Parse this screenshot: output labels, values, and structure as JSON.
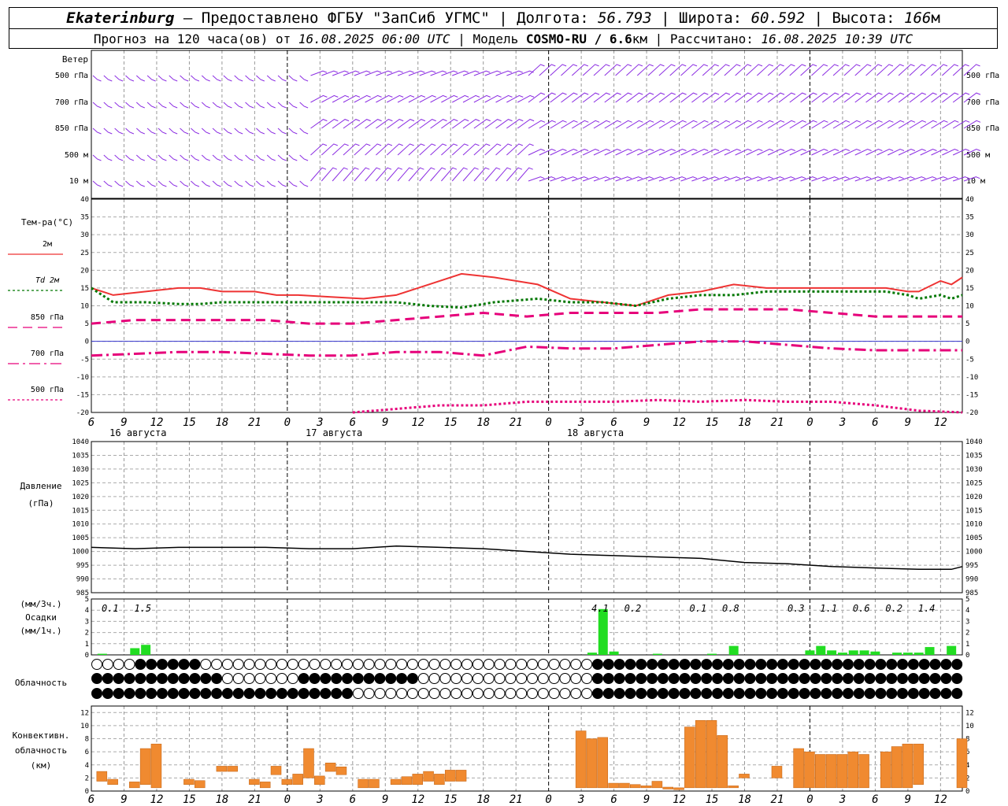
{
  "header": {
    "city": "Ekaterinburg",
    "source": " – Предоставлено ФГБУ \"ЗапСиб УГМС\" | Долгота: ",
    "lon": "56.793",
    "lat_label": " | Широта: ",
    "lat": "60.592",
    "alt_label": " | Высота: ",
    "alt": "166",
    "alt_unit": "м",
    "forecast_prefix": "Прогноз на 120 часа(ов) от ",
    "forecast_time": "16.08.2025 06:00 UTC",
    "model_label": " | Модель ",
    "model": "COSMO-RU / 6.6",
    "model_unit": "км",
    "calc_label": " | Рассчитано: ",
    "calc_time": "16.08.2025 10:39 UTC"
  },
  "labels": {
    "wind": "Ветер",
    "wind_levels": [
      "500 гПа",
      "700 гПа",
      "850 гПа",
      "500 м",
      "10  м"
    ],
    "temp_title": "Тем-ра(°С)",
    "temp_legend": [
      "2м",
      "Td  2м",
      "850 гПа",
      "700 гПа",
      "500 гПа"
    ],
    "pressure": [
      "Давление",
      "(гПа)"
    ],
    "precip": [
      "(мм/3ч.)",
      "Осадки",
      "(мм/1ч.)"
    ],
    "cloud": "Облачность",
    "conv": [
      "Конвективн.",
      "облачность",
      "(км)"
    ]
  },
  "time_ticks": [
    "6",
    "9",
    "12",
    "15",
    "18",
    "21",
    "0",
    "3",
    "6",
    "9",
    "12",
    "15",
    "18",
    "21",
    "0",
    "3",
    "6",
    "9",
    "12",
    "15",
    "18",
    "21",
    "0",
    "3",
    "6",
    "9",
    "12"
  ],
  "dates": [
    "16 августа",
    "17 августа",
    "18 августа"
  ],
  "precip_3h_labels": [
    {
      "t": 1,
      "v": "0.1"
    },
    {
      "t": 4,
      "v": "1.5"
    },
    {
      "t": 46,
      "v": "4.1"
    },
    {
      "t": 49,
      "v": "0.2"
    },
    {
      "t": 55,
      "v": "0.1"
    },
    {
      "t": 58,
      "v": "0.8"
    },
    {
      "t": 64,
      "v": "0.3"
    },
    {
      "t": 67,
      "v": "1.1"
    },
    {
      "t": 70,
      "v": "0.6"
    },
    {
      "t": 73,
      "v": "0.2"
    },
    {
      "t": 76,
      "v": "1.4"
    }
  ],
  "chart_data": {
    "type": "line",
    "x_start": "16.08.2025 06:00 UTC",
    "x_step_hours": 1,
    "temperature": {
      "ylim": [
        -20,
        40
      ],
      "series": [
        {
          "name": "2м",
          "color": "#ee3333",
          "style": "solid",
          "t": [
            0,
            2,
            5,
            8,
            10,
            12,
            15,
            17,
            19,
            22,
            25,
            28,
            31,
            34,
            37,
            41,
            44,
            47,
            50,
            53,
            56,
            59,
            62,
            65,
            68,
            71,
            73,
            75,
            76,
            78,
            79,
            80
          ],
          "values": [
            15,
            13,
            14,
            15,
            15,
            14,
            14,
            13,
            13,
            12.5,
            12,
            13,
            16,
            19,
            18,
            16,
            12,
            11,
            10,
            13,
            14,
            16,
            15,
            15,
            15,
            15,
            15,
            14,
            14,
            17,
            16,
            18
          ]
        },
        {
          "name": "Td  2м",
          "color": "#007700",
          "style": "dot",
          "t": [
            0,
            2,
            5,
            8,
            10,
            12,
            15,
            17,
            19,
            22,
            25,
            28,
            31,
            34,
            37,
            41,
            44,
            47,
            50,
            53,
            56,
            59,
            62,
            65,
            68,
            71,
            73,
            75,
            76,
            78,
            79,
            80
          ],
          "values": [
            15,
            11,
            11,
            10.5,
            10.5,
            11,
            11,
            11,
            11,
            11,
            11,
            11,
            10,
            9.5,
            11,
            12,
            11,
            11,
            10,
            12,
            13,
            13,
            14,
            14,
            14,
            14,
            14,
            13,
            12,
            13,
            12,
            13
          ]
        },
        {
          "name": "850 гПа",
          "color": "#e6007a",
          "style": "dash",
          "t": [
            0,
            4,
            8,
            12,
            16,
            20,
            24,
            28,
            32,
            36,
            40,
            44,
            48,
            52,
            56,
            60,
            64,
            68,
            72,
            76,
            80
          ],
          "values": [
            5,
            6,
            6,
            6,
            6,
            5,
            5,
            6,
            7,
            8,
            7,
            8,
            8,
            8,
            9,
            9,
            9,
            8,
            7,
            7,
            7
          ]
        },
        {
          "name": "700 гПа",
          "color": "#e6007a",
          "style": "dashdot",
          "t": [
            0,
            4,
            8,
            12,
            16,
            20,
            24,
            28,
            32,
            36,
            40,
            44,
            48,
            52,
            56,
            60,
            64,
            68,
            72,
            76,
            80
          ],
          "values": [
            -4,
            -3.5,
            -3,
            -3,
            -3.5,
            -4,
            -4,
            -3,
            -3,
            -4,
            -1.5,
            -2,
            -2,
            -1,
            0,
            0,
            -1,
            -2,
            -2.5,
            -2.5,
            -2.5
          ]
        },
        {
          "name": "500 гПа",
          "color": "#e6007a",
          "style": "dot",
          "t": [
            0,
            4,
            8,
            12,
            16,
            20,
            24,
            28,
            32,
            36,
            40,
            44,
            48,
            52,
            56,
            60,
            64,
            68,
            72,
            76,
            80
          ],
          "values": [
            null,
            null,
            null,
            null,
            null,
            null,
            -20,
            -19,
            -18,
            -18,
            -17,
            -17,
            -17,
            -16.5,
            -17,
            -16.5,
            -17,
            -17,
            -18,
            -19.5,
            -20
          ]
        }
      ]
    },
    "pressure": {
      "ylim": [
        985,
        1040
      ],
      "t": [
        0,
        4,
        8,
        12,
        16,
        20,
        24,
        28,
        32,
        36,
        40,
        44,
        48,
        52,
        56,
        60,
        64,
        68,
        72,
        76,
        79,
        80
      ],
      "values": [
        1001.5,
        1001,
        1001.5,
        1001.5,
        1001.5,
        1001,
        1001,
        1002,
        1001.5,
        1001,
        1000,
        999,
        998.5,
        998,
        997.5,
        996,
        995.5,
        994.5,
        994,
        993.5,
        993.5,
        994.5
      ]
    },
    "precip": {
      "ylim": [
        0,
        5
      ],
      "t": [
        1,
        4,
        5,
        46,
        47,
        48,
        52,
        57,
        59,
        66,
        67,
        68,
        69,
        70,
        71,
        72,
        74,
        75,
        76,
        77,
        79
      ],
      "values": [
        0.1,
        0.6,
        0.9,
        0.2,
        4.1,
        0.3,
        0.1,
        0.1,
        0.8,
        0.4,
        0.8,
        0.4,
        0.2,
        0.4,
        0.4,
        0.3,
        0.2,
        0.2,
        0.2,
        0.7,
        0.8
      ]
    },
    "convective": {
      "ylim": [
        0,
        13
      ],
      "bars": [
        {
          "t": 1,
          "b": 1.5,
          "h": 3
        },
        {
          "t": 2,
          "b": 1,
          "h": 1.8
        },
        {
          "t": 4,
          "b": 0.5,
          "h": 1.4
        },
        {
          "t": 5,
          "b": 1,
          "h": 6.5
        },
        {
          "t": 6,
          "b": 0.5,
          "h": 7.2
        },
        {
          "t": 9,
          "b": 1,
          "h": 1.8
        },
        {
          "t": 10,
          "b": 0.5,
          "h": 1.6
        },
        {
          "t": 12,
          "b": 3,
          "h": 3.8
        },
        {
          "t": 13,
          "b": 3,
          "h": 3.8
        },
        {
          "t": 15,
          "b": 1,
          "h": 1.8
        },
        {
          "t": 16,
          "b": 0.5,
          "h": 1.4
        },
        {
          "t": 17,
          "b": 2.5,
          "h": 3.8
        },
        {
          "t": 18,
          "b": 1,
          "h": 1.8
        },
        {
          "t": 19,
          "b": 1,
          "h": 2.6
        },
        {
          "t": 20,
          "b": 2,
          "h": 6.5
        },
        {
          "t": 21,
          "b": 1,
          "h": 2.3
        },
        {
          "t": 22,
          "b": 3,
          "h": 4.3
        },
        {
          "t": 23,
          "b": 2.5,
          "h": 3.7
        },
        {
          "t": 25,
          "b": 0.5,
          "h": 1.8
        },
        {
          "t": 26,
          "b": 0.5,
          "h": 1.8
        },
        {
          "t": 28,
          "b": 1,
          "h": 1.8
        },
        {
          "t": 29,
          "b": 1,
          "h": 2.2
        },
        {
          "t": 30,
          "b": 1,
          "h": 2.6
        },
        {
          "t": 31,
          "b": 1.5,
          "h": 3
        },
        {
          "t": 32,
          "b": 1,
          "h": 2.6
        },
        {
          "t": 33,
          "b": 1.5,
          "h": 3.2
        },
        {
          "t": 34,
          "b": 1.5,
          "h": 3.2
        },
        {
          "t": 45,
          "b": 0.5,
          "h": 9.2
        },
        {
          "t": 46,
          "b": 0.5,
          "h": 8
        },
        {
          "t": 47,
          "b": 0.5,
          "h": 8.2
        },
        {
          "t": 48,
          "b": 0.5,
          "h": 1.2
        },
        {
          "t": 49,
          "b": 0.5,
          "h": 1.2
        },
        {
          "t": 50,
          "b": 0.5,
          "h": 1
        },
        {
          "t": 51,
          "b": 0.5,
          "h": 0.8
        },
        {
          "t": 52,
          "b": 0.5,
          "h": 1.5
        },
        {
          "t": 53,
          "b": 0.3,
          "h": 0.6
        },
        {
          "t": 54,
          "b": 0.2,
          "h": 0.5
        },
        {
          "t": 55,
          "b": 0.5,
          "h": 9.8
        },
        {
          "t": 56,
          "b": 0.5,
          "h": 10.8
        },
        {
          "t": 57,
          "b": 0.5,
          "h": 10.8
        },
        {
          "t": 58,
          "b": 0.5,
          "h": 8.5
        },
        {
          "t": 59,
          "b": 0.5,
          "h": 0.8
        },
        {
          "t": 60,
          "b": 2,
          "h": 2.6
        },
        {
          "t": 63,
          "b": 2,
          "h": 3.8
        },
        {
          "t": 65,
          "b": 0.5,
          "h": 6.5
        },
        {
          "t": 66,
          "b": 0.5,
          "h": 6
        },
        {
          "t": 67,
          "b": 0.5,
          "h": 5.6
        },
        {
          "t": 68,
          "b": 0.5,
          "h": 5.6
        },
        {
          "t": 69,
          "b": 0.5,
          "h": 5.6
        },
        {
          "t": 70,
          "b": 0.5,
          "h": 6
        },
        {
          "t": 71,
          "b": 0.5,
          "h": 5.6
        },
        {
          "t": 73,
          "b": 0.5,
          "h": 6
        },
        {
          "t": 74,
          "b": 0.5,
          "h": 6.8
        },
        {
          "t": 75,
          "b": 0.5,
          "h": 7.2
        },
        {
          "t": 76,
          "b": 1,
          "h": 7.2
        },
        {
          "t": 80,
          "b": 0.5,
          "h": 8
        }
      ]
    },
    "colors": {
      "t2m": "#ee3333",
      "td": "#007700",
      "levels": "#e6007a",
      "wind": "#8a2be2",
      "precip": "#22dd22",
      "conv": "#f08a30",
      "zero": "#3333cc"
    }
  }
}
